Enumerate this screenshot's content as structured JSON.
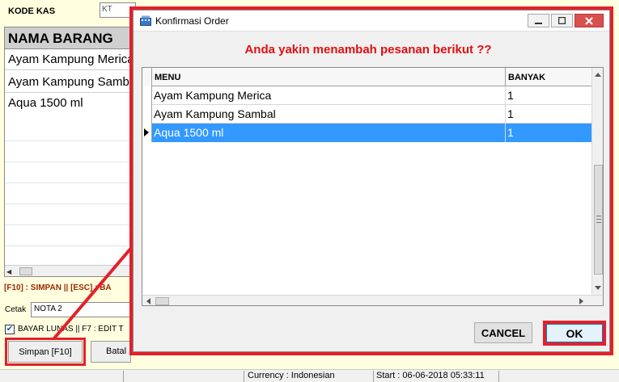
{
  "form": {
    "kode_kas_label": "KODE KAS",
    "kode_kas_value": "KT",
    "grid_header": "NAMA BARANG",
    "grid_rows": [
      "Ayam Kampung Merica",
      "Ayam Kampung Sambal",
      "Aqua 1500 ml"
    ],
    "shortcuts": "[F10] : SIMPAN  ||  [ESC] : BA",
    "cetak_label": "Cetak",
    "cetak_value": "NOTA 2",
    "bayar_label": "BAYAR LUNAS || F7 : EDIT T",
    "simpan_label": "Simpan [F10]",
    "batal_label": "Batal"
  },
  "statusbar": {
    "currency": "Currency : Indonesian",
    "start": "Start  : 06-06-2018 05:33:11"
  },
  "dialog": {
    "title": "Konfirmasi Order",
    "question": "Anda yakin menambah pesanan berikut ??",
    "columns": [
      "MENU",
      "BANYAK"
    ],
    "rows": [
      {
        "menu": "Ayam Kampung Merica",
        "banyak": "1"
      },
      {
        "menu": "Ayam Kampung Sambal",
        "banyak": "1"
      },
      {
        "menu": "Aqua 1500 ml",
        "banyak": "1"
      }
    ],
    "selected_row": 2,
    "cancel_label": "CANCEL",
    "ok_label": "OK"
  },
  "colors": {
    "highlight": "#e3202a",
    "question": "#e01010",
    "selection": "#3399ff"
  }
}
